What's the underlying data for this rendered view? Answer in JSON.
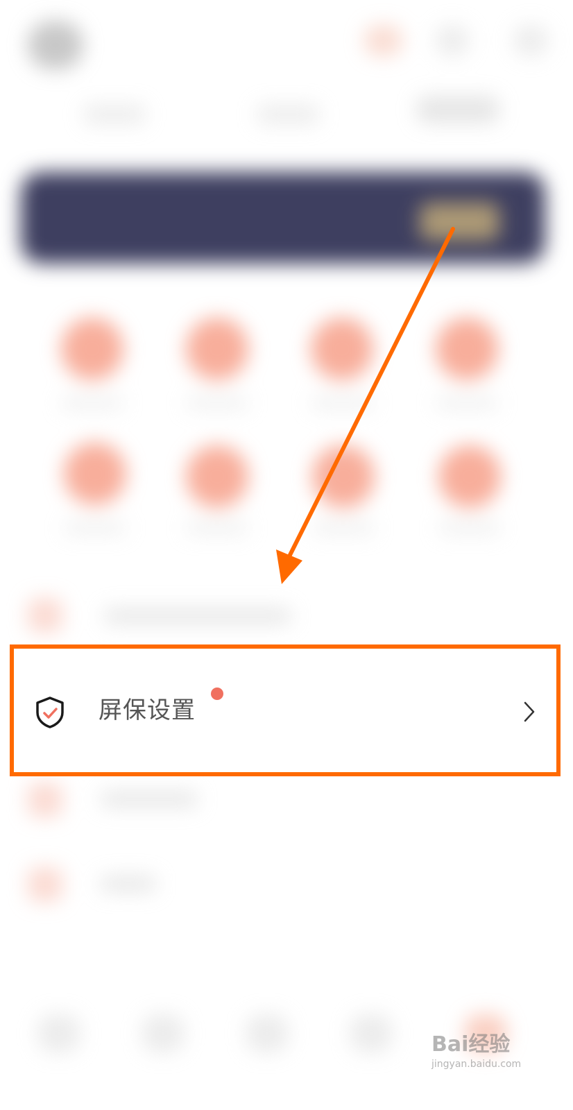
{
  "highlighted_row": {
    "label": "屏保设置",
    "icon": "shield-check-icon",
    "has_notification_dot": true,
    "chevron": "chevron-right-icon"
  },
  "annotation": {
    "arrow_color": "#ff6a00",
    "box_color": "#ff6a00"
  },
  "watermark": {
    "brand": "Bai经验",
    "url": "jingyan.baidu.com"
  },
  "colors": {
    "accent": "#f0705f",
    "banner": "#2e2f52",
    "text": "#555555"
  }
}
